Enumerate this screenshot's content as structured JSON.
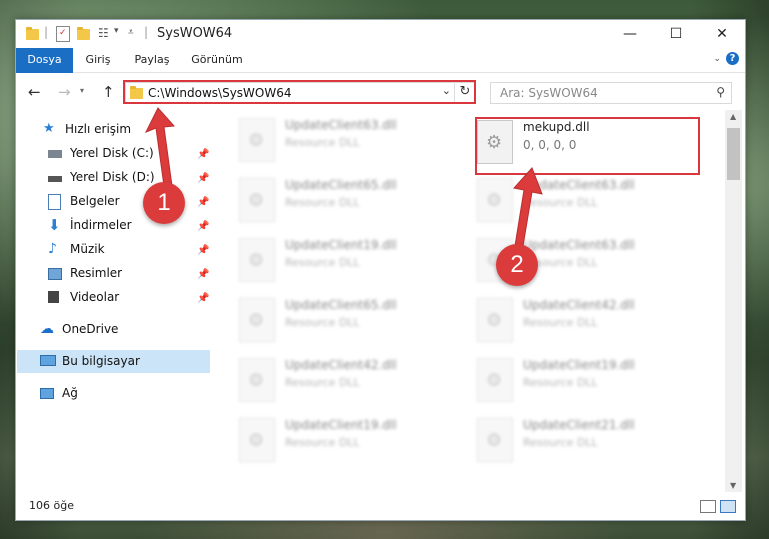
{
  "window": {
    "title": "SysWOW64",
    "minimize_glyph": "—",
    "maximize_glyph": "☐",
    "close_glyph": "✕"
  },
  "ribbon": {
    "tabs": [
      "Dosya",
      "Giriş",
      "Paylaş",
      "Görünüm"
    ],
    "accent": "#1a6ec4"
  },
  "navigation": {
    "address": "C:\\Windows\\SysWOW64",
    "search_placeholder": "Ara: SysWOW64"
  },
  "sidebar": {
    "items": [
      {
        "label": "Hızlı erişim",
        "icon": "star-icon"
      },
      {
        "label": "Yerel Disk (C:)",
        "icon": "drive-icon"
      },
      {
        "label": "Yerel Disk (D:)",
        "icon": "drive-icon"
      },
      {
        "label": "Belgeler",
        "icon": "documents-icon"
      },
      {
        "label": "İndirmeler",
        "icon": "download-icon"
      },
      {
        "label": "Müzik",
        "icon": "music-icon"
      },
      {
        "label": "Resimler",
        "icon": "pictures-icon"
      },
      {
        "label": "Videolar",
        "icon": "videos-icon"
      },
      {
        "label": "OneDrive",
        "icon": "cloud-icon"
      },
      {
        "label": "Bu bilgisayar",
        "icon": "computer-icon"
      },
      {
        "label": "Ağ",
        "icon": "network-icon"
      }
    ],
    "selected": "Bu bilgisayar"
  },
  "files": {
    "highlighted": {
      "name": "mekupd.dll",
      "detail": "0, 0, 0, 0"
    },
    "left_column": [
      {
        "name": "UpdateClient63.dll",
        "type": "Resource DLL"
      },
      {
        "name": "UpdateClient65.dll",
        "type": "Resource DLL"
      },
      {
        "name": "UpdateClient19.dll",
        "type": "Resource DLL"
      },
      {
        "name": "UpdateClient65.dll",
        "type": "Resource DLL"
      },
      {
        "name": "UpdateClient42.dll",
        "type": "Resource DLL"
      },
      {
        "name": "UpdateClient19.dll",
        "type": "Resource DLL"
      }
    ],
    "right_column": [
      {
        "name": "UpdateClient63.dll",
        "type": "Resource DLL"
      },
      {
        "name": "UpdateClient63.dll",
        "type": "Resource DLL"
      },
      {
        "name": "UpdateClient42.dll",
        "type": "Resource DLL"
      },
      {
        "name": "UpdateClient19.dll",
        "type": "Resource DLL"
      },
      {
        "name": "UpdateClient21.dll",
        "type": "Resource DLL"
      }
    ]
  },
  "status": {
    "item_count": "106 öğe"
  },
  "callouts": {
    "step1": "1",
    "step2": "2",
    "color": "#dc3b3b"
  }
}
